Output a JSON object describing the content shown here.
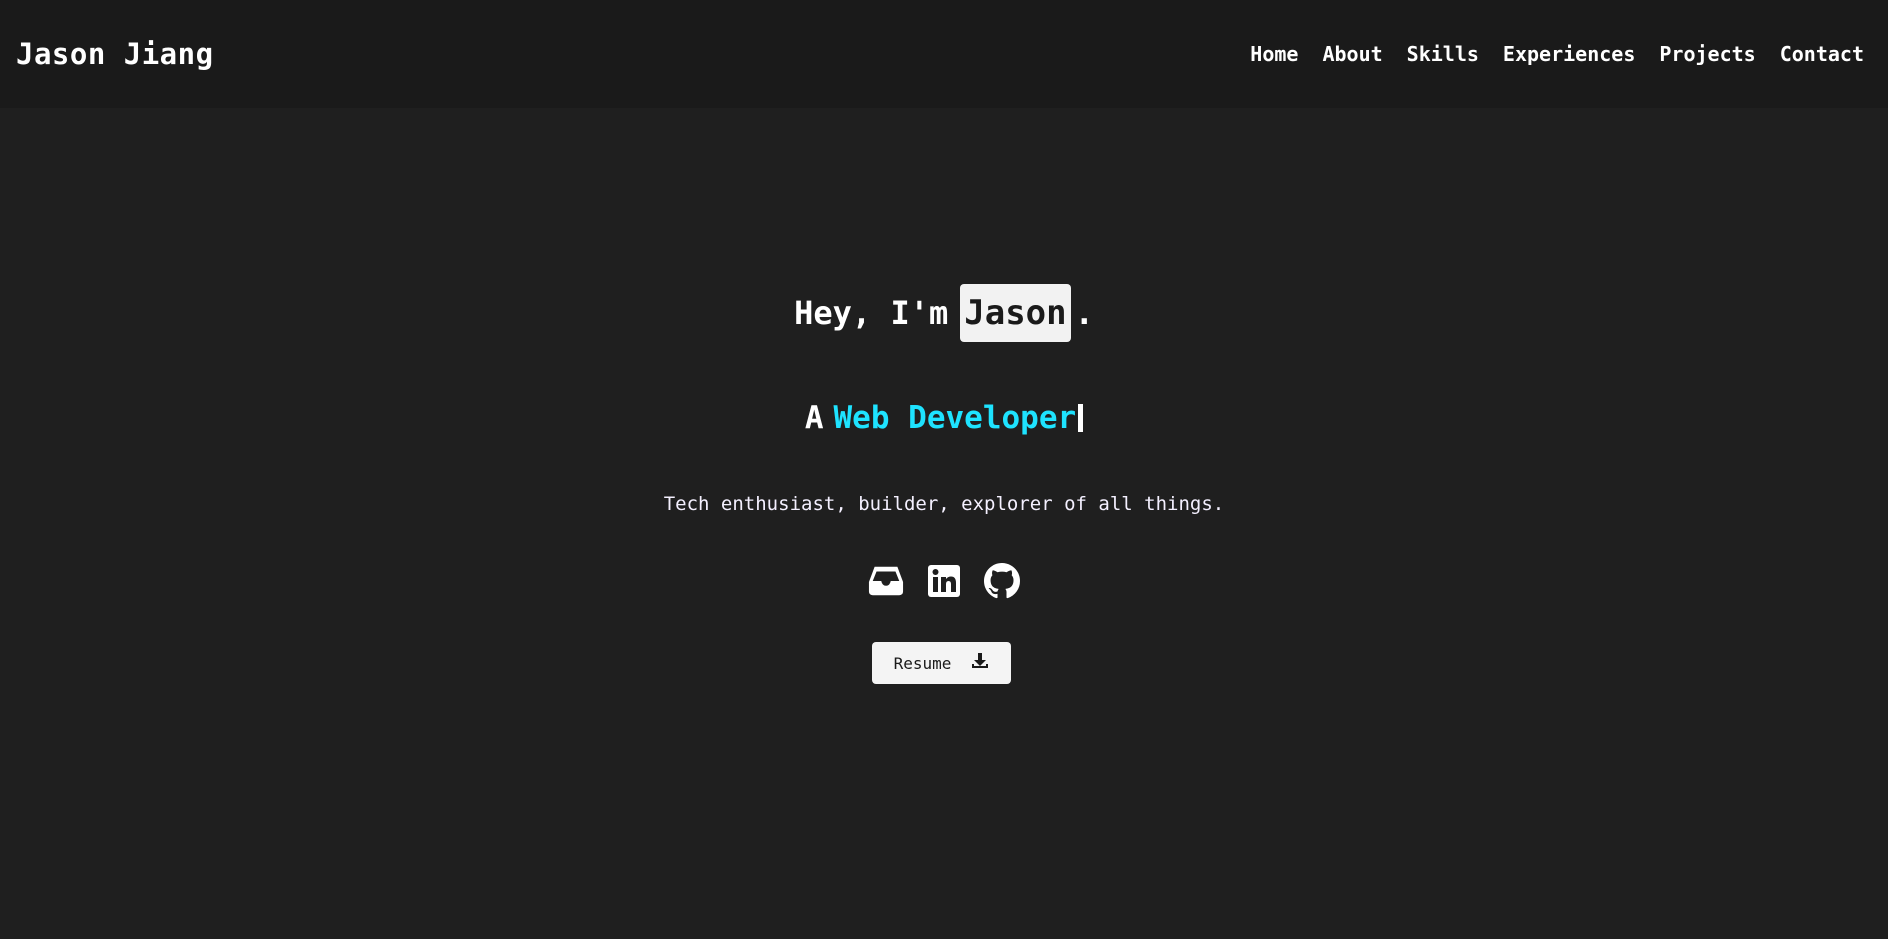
{
  "colors": {
    "background": "#1f1f1f",
    "navbar": "#1a1a1a",
    "accent": "#1ee3ff",
    "text": "#ffffff"
  },
  "navbar": {
    "brand": "Jason Jiang",
    "links": [
      {
        "label": "Home"
      },
      {
        "label": "About"
      },
      {
        "label": "Skills"
      },
      {
        "label": "Experiences"
      },
      {
        "label": "Projects"
      },
      {
        "label": "Contact"
      }
    ]
  },
  "hero": {
    "greeting_prefix": "Hey, I'm",
    "name": "Jason",
    "greeting_suffix": ".",
    "role_prefix": "A",
    "role": "Web Developer",
    "tagline": "Tech enthusiast, builder, explorer of all things.",
    "socials": [
      {
        "icon": "inbox-icon"
      },
      {
        "icon": "linkedin-icon"
      },
      {
        "icon": "github-icon"
      }
    ],
    "resume_label": "Resume",
    "resume_icon": "download-icon"
  }
}
